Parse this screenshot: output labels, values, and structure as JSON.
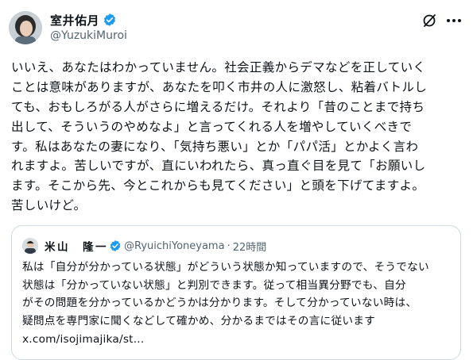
{
  "author": {
    "display_name": "室井佑月",
    "handle": "@YuzukiMuroi"
  },
  "tweet": {
    "lines": [
      "いいえ、あなたはわかっていません。社会正義からデマなどを正していく",
      "ことは意味がありますが、あなたを叩く市井の人に激怒し、粘着バトルし",
      "ても、おもしろがる人がさらに増えるだけ。それより「昔のことまで持ち",
      "出して、そういうのやめなよ」と言ってくれる人を増やしていくべきで",
      "す。私はあなたの妻になり、「気持ち悪い」とか「パパ活」とかよく言わ",
      "れますよ。苦しいですが、直にいわれたら、真っ直ぐ目を見て「お願いし",
      "ます。そこから先、今とこれからも見てください」と頭を下げてますよ。",
      "苦しいけど。"
    ]
  },
  "quote": {
    "display_name": "米山　隆一",
    "handle": "@RyuichiYoneyama",
    "separator": "·",
    "time": "22時間",
    "lines": [
      "私は「自分が分かっている状態」がどういう状態か知っていますので、そうでない",
      "状態は「分かっていない状態」と判別できます。従って相当異分野でも、自分",
      "がその問題を分かっているかどうかは分かります。そして分かっていない時は、",
      "疑問点を専門家に聞くなどして確かめ、分かるまではその言に従います",
      "x.com/isojimajika/st..."
    ]
  },
  "colors": {
    "verified": "#1d9bf0",
    "secondary_text": "#536471",
    "border": "#cfd9de"
  },
  "icons": [
    "verified-badge-icon",
    "grok-icon",
    "more-icon"
  ]
}
